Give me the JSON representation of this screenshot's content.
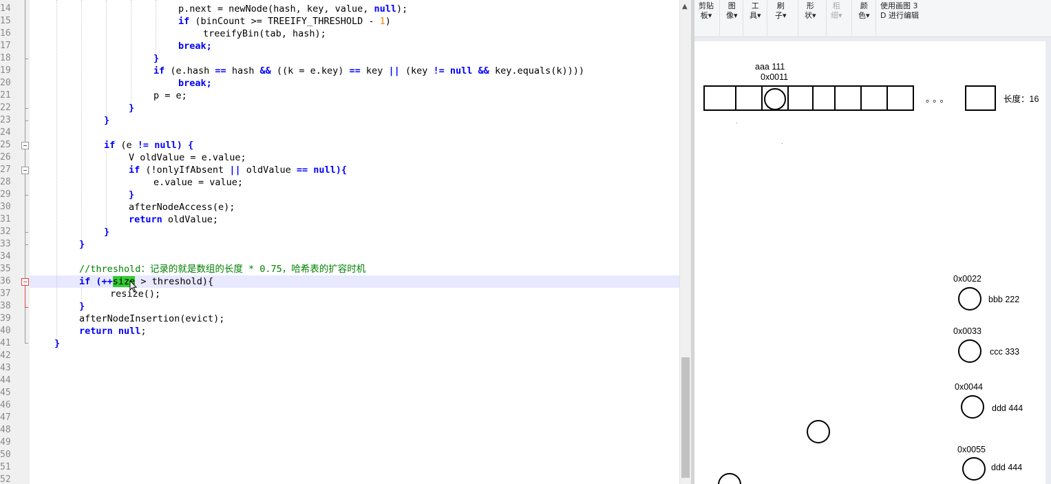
{
  "editor": {
    "line_numbers": [
      "14",
      "15",
      "16",
      "17",
      "18",
      "19",
      "20",
      "21",
      "22",
      "23",
      "24",
      "25",
      "26",
      "27",
      "28",
      "29",
      "30",
      "31",
      "32",
      "33",
      "34",
      "35",
      "36",
      "37",
      "38",
      "39",
      "40",
      "41",
      "42",
      "43",
      "44",
      "45",
      "46",
      "47",
      "48",
      "49",
      "50",
      "51",
      "52"
    ],
    "code": {
      "l14_a": "p.next = newNode(hash, key, value, ",
      "l14_null": "null",
      "l14_b": ");",
      "l15_if": "if",
      "l15_a": " (binCount >= TREEIFY_THRESHOLD - ",
      "l15_num": "1",
      "l15_b": ")",
      "l16": "treeifyBin(tab, hash);",
      "l17": "break;",
      "l18": "}",
      "l19_if": "if",
      "l19_a": " (e.hash ",
      "l19_eq1": "==",
      "l19_b": " hash ",
      "l19_and1": "&&",
      "l19_c": " ((k = e.key) ",
      "l19_eq2": "==",
      "l19_d": " key ",
      "l19_or": "||",
      "l19_e": " (key ",
      "l19_ne": "!=",
      "l19_f": " ",
      "l19_null": "null",
      "l19_g": " ",
      "l19_and2": "&&",
      "l19_h": " key.equals(k))))",
      "l20": "break;",
      "l21": "p = e;",
      "l22": "}",
      "l23": "}",
      "l25_if": "if",
      "l25_a": " (e ",
      "l25_ne": "!=",
      "l25_b": " ",
      "l25_null": "null",
      "l25_c": ") {",
      "l26": "V oldValue = e.value;",
      "l27_if": "if",
      "l27_a": " (!onlyIfAbsent ",
      "l27_or": "||",
      "l27_b": " oldValue ",
      "l27_eq": "==",
      "l27_c": " ",
      "l27_null": "null",
      "l27_d": "){",
      "l28": "e.value = value;",
      "l29": "}",
      "l30": "afterNodeAccess(e);",
      "l31_ret": "return",
      "l31_a": " oldValue;",
      "l32": "}",
      "l33": "}",
      "l35": "//threshold：记录的就是数组的长度 * 0.75，哈希表的扩容时机",
      "l36_if": "if",
      "l36_a": " (++",
      "l36_size": "size",
      "l36_b": " > threshold){",
      "l37": "resize();",
      "l38": "}",
      "l39": "afterNodeInsertion(evict);",
      "l40_ret": "return",
      "l40_sp": " ",
      "l40_null": "null",
      "l40_semi": ";",
      "l41": "}"
    }
  },
  "ribbon": {
    "clipboard": [
      "剪贴",
      "板▾"
    ],
    "image": [
      "图",
      "像▾"
    ],
    "tools": [
      "工",
      "具▾"
    ],
    "brush": [
      "刷",
      "子▾"
    ],
    "shapes": [
      "形",
      "状▾"
    ],
    "size": [
      "粗",
      "细▾"
    ],
    "colors": [
      "颜",
      "色▾"
    ],
    "paint3d": [
      "使用画图 3",
      "D 进行编辑"
    ]
  },
  "canvas": {
    "entry1_kv": "aaa  111",
    "entry1_hash": "0x0011",
    "ellipsis": "。。。",
    "length_label": "长度：16",
    "entries": [
      {
        "hash": "0x0022",
        "kv": "bbb 222"
      },
      {
        "hash": "0x0033",
        "kv": "ccc 333"
      },
      {
        "hash": "0x0044",
        "kv": "ddd 444"
      },
      {
        "hash": "0x0055",
        "kv": "ddd 444"
      }
    ]
  },
  "colors": {
    "keyword": "#0000ff",
    "number": "#ff8000",
    "comment": "#008000",
    "word_highlight": "#33cc33",
    "current_line": "#e8e8ff",
    "fold_marker": "#e04040"
  }
}
